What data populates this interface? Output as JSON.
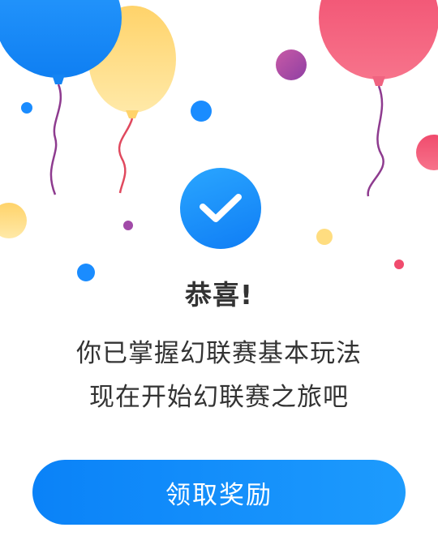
{
  "dialog": {
    "title": "恭喜!",
    "message_line1": "你已掌握幻联赛基本玩法",
    "message_line2": "现在开始幻联赛之旅吧",
    "claim_button_label": "领取奖励"
  },
  "icons": {
    "success": "checkmark-icon",
    "decoration": "balloon-icon"
  },
  "colors": {
    "primary_blue": "#1a8cff",
    "balloon_yellow": "#ffd666",
    "balloon_pink": "#f0506e",
    "dot_purple": "#a14aa8",
    "text": "#333333",
    "button_text": "#ffffff"
  }
}
